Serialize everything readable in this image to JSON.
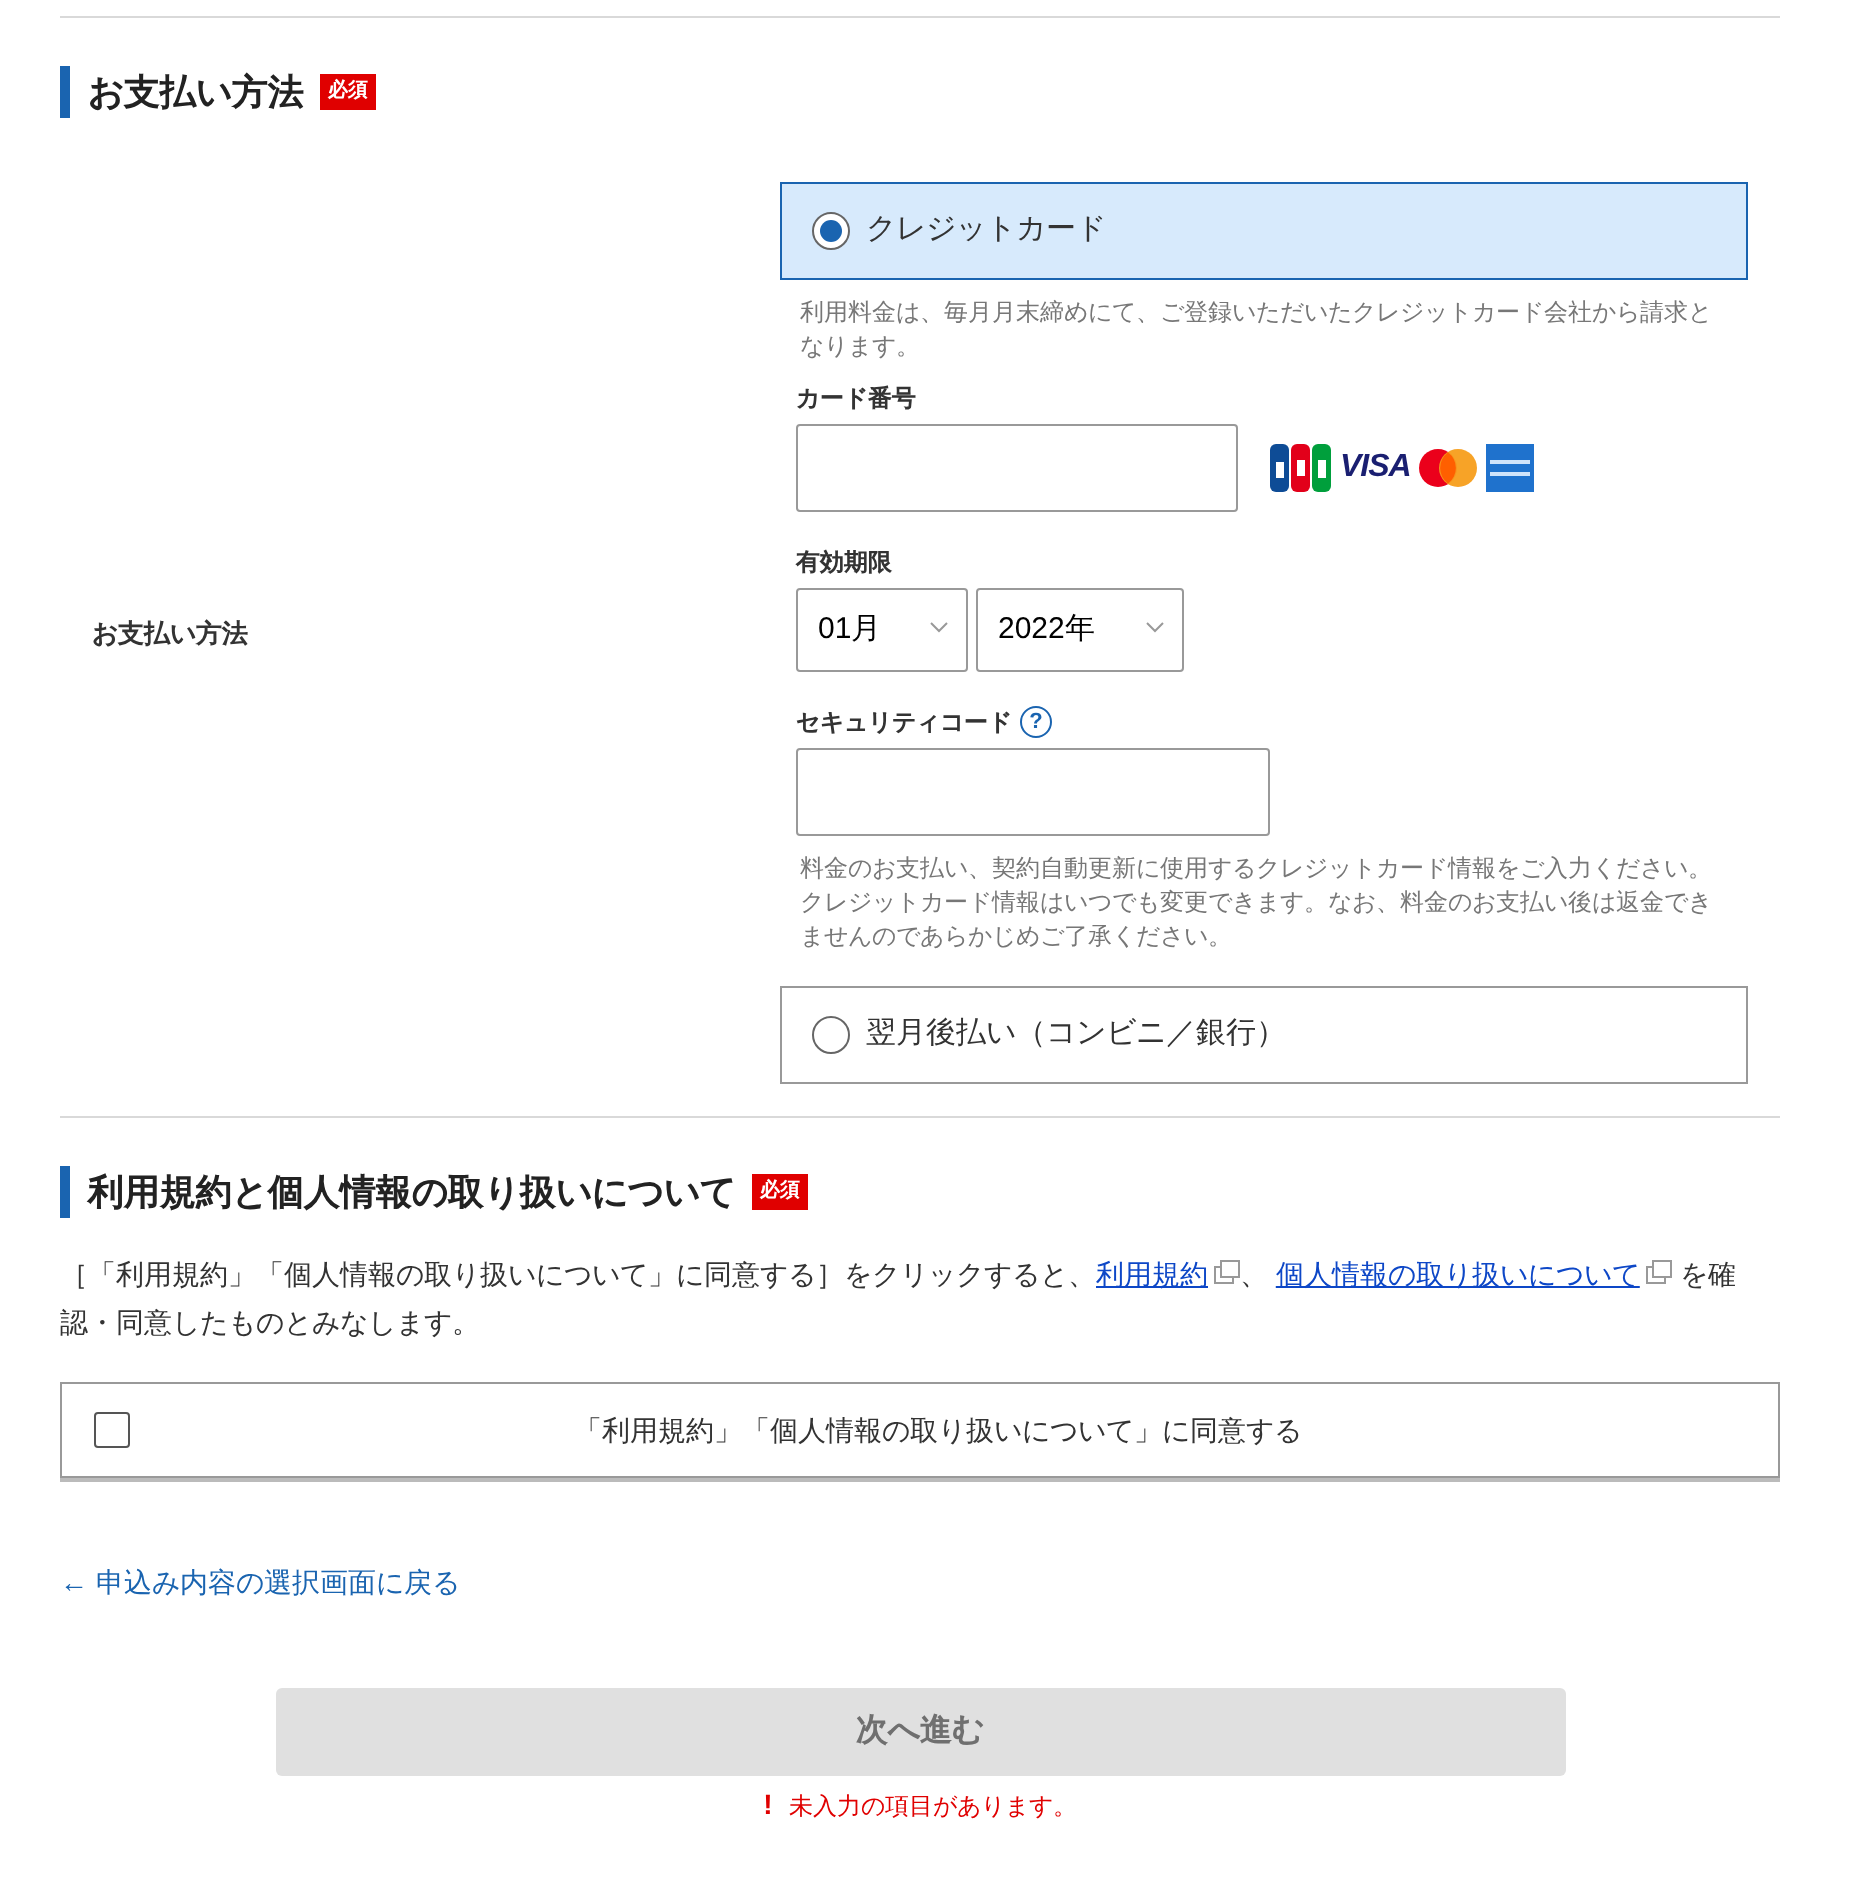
{
  "payment_section": {
    "heading": "お支払い方法",
    "required_badge": "必須",
    "row_label": "お支払い方法",
    "methods": [
      {
        "kind": "card",
        "label": "クレジットカード",
        "selected": true
      },
      {
        "kind": "deferred",
        "label": "翌月後払い（コンビニ／銀行）",
        "selected": false
      }
    ],
    "card_note": "利用料金は、毎月月末締めにて、ご登録いただいたクレジットカード会社から請求となります。",
    "card_number": {
      "label": "カード番号"
    },
    "brands": [
      {
        "kind": "jcb"
      },
      {
        "kind": "visa",
        "text": "VISA"
      },
      {
        "kind": "mastercard"
      },
      {
        "kind": "amex"
      }
    ],
    "expiry": {
      "label": "有効期限",
      "month": "01月",
      "year": "2022年"
    },
    "security_code": {
      "label": "セキュリティコード",
      "help": "?"
    },
    "card_footer_note": "料金のお支払い、契約自動更新に使用するクレジットカード情報をご入力ください。クレジットカード情報はいつでも変更できます。なお、料金のお支払い後は返金できませんのであらかじめご了承ください。"
  },
  "terms_section": {
    "heading": "利用規約と個人情報の取り扱いについて",
    "required_badge": "必須",
    "notice": [
      {
        "kind": "text",
        "text": "［「利用規約」「個人情報の取り扱いについて」に同意する］をクリックすると、"
      },
      {
        "kind": "link",
        "text": "利用規約"
      },
      {
        "kind": "text",
        "text": "、 "
      },
      {
        "kind": "link",
        "text": "個人情報の取り扱いについて"
      },
      {
        "kind": "text",
        "text": " を確認・同意したものとみなします。"
      }
    ],
    "agree": {
      "label": "「利用規約」「個人情報の取り扱いについて」に同意する",
      "checked": false
    }
  },
  "back_link": "← 申込み内容の選択画面に戻る",
  "next_button": {
    "label": "次へ進む",
    "disabled": true
  },
  "error": {
    "icon": "!",
    "text": "未入力の項目があります。"
  }
}
